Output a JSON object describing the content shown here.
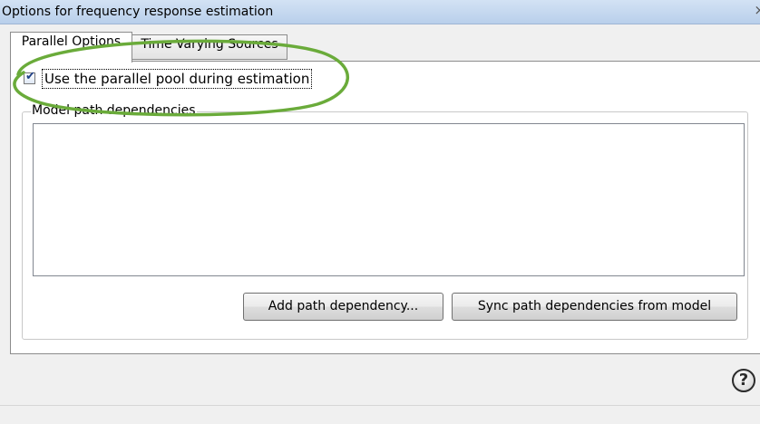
{
  "window": {
    "title": "Options for frequency response estimation",
    "close_glyph": "×"
  },
  "tabs": [
    {
      "label": "Parallel Options",
      "selected": true
    },
    {
      "label": "Time Varying Sources",
      "selected": false
    }
  ],
  "parallel_options": {
    "use_pool_checkbox": {
      "label": "Use the parallel pool during estimation",
      "checked": true
    },
    "model_path_group": {
      "label": "Model path dependencies",
      "items": []
    },
    "add_button_label": "Add path dependency...",
    "sync_button_label": "Sync path dependencies from model"
  },
  "footer": {
    "help_glyph": "?",
    "help_icon": "help-icon"
  },
  "colors": {
    "annotation_ellipse": "#6aab3a",
    "checkmark": "#1e3f86",
    "titlebar": "#c6d9f1"
  }
}
